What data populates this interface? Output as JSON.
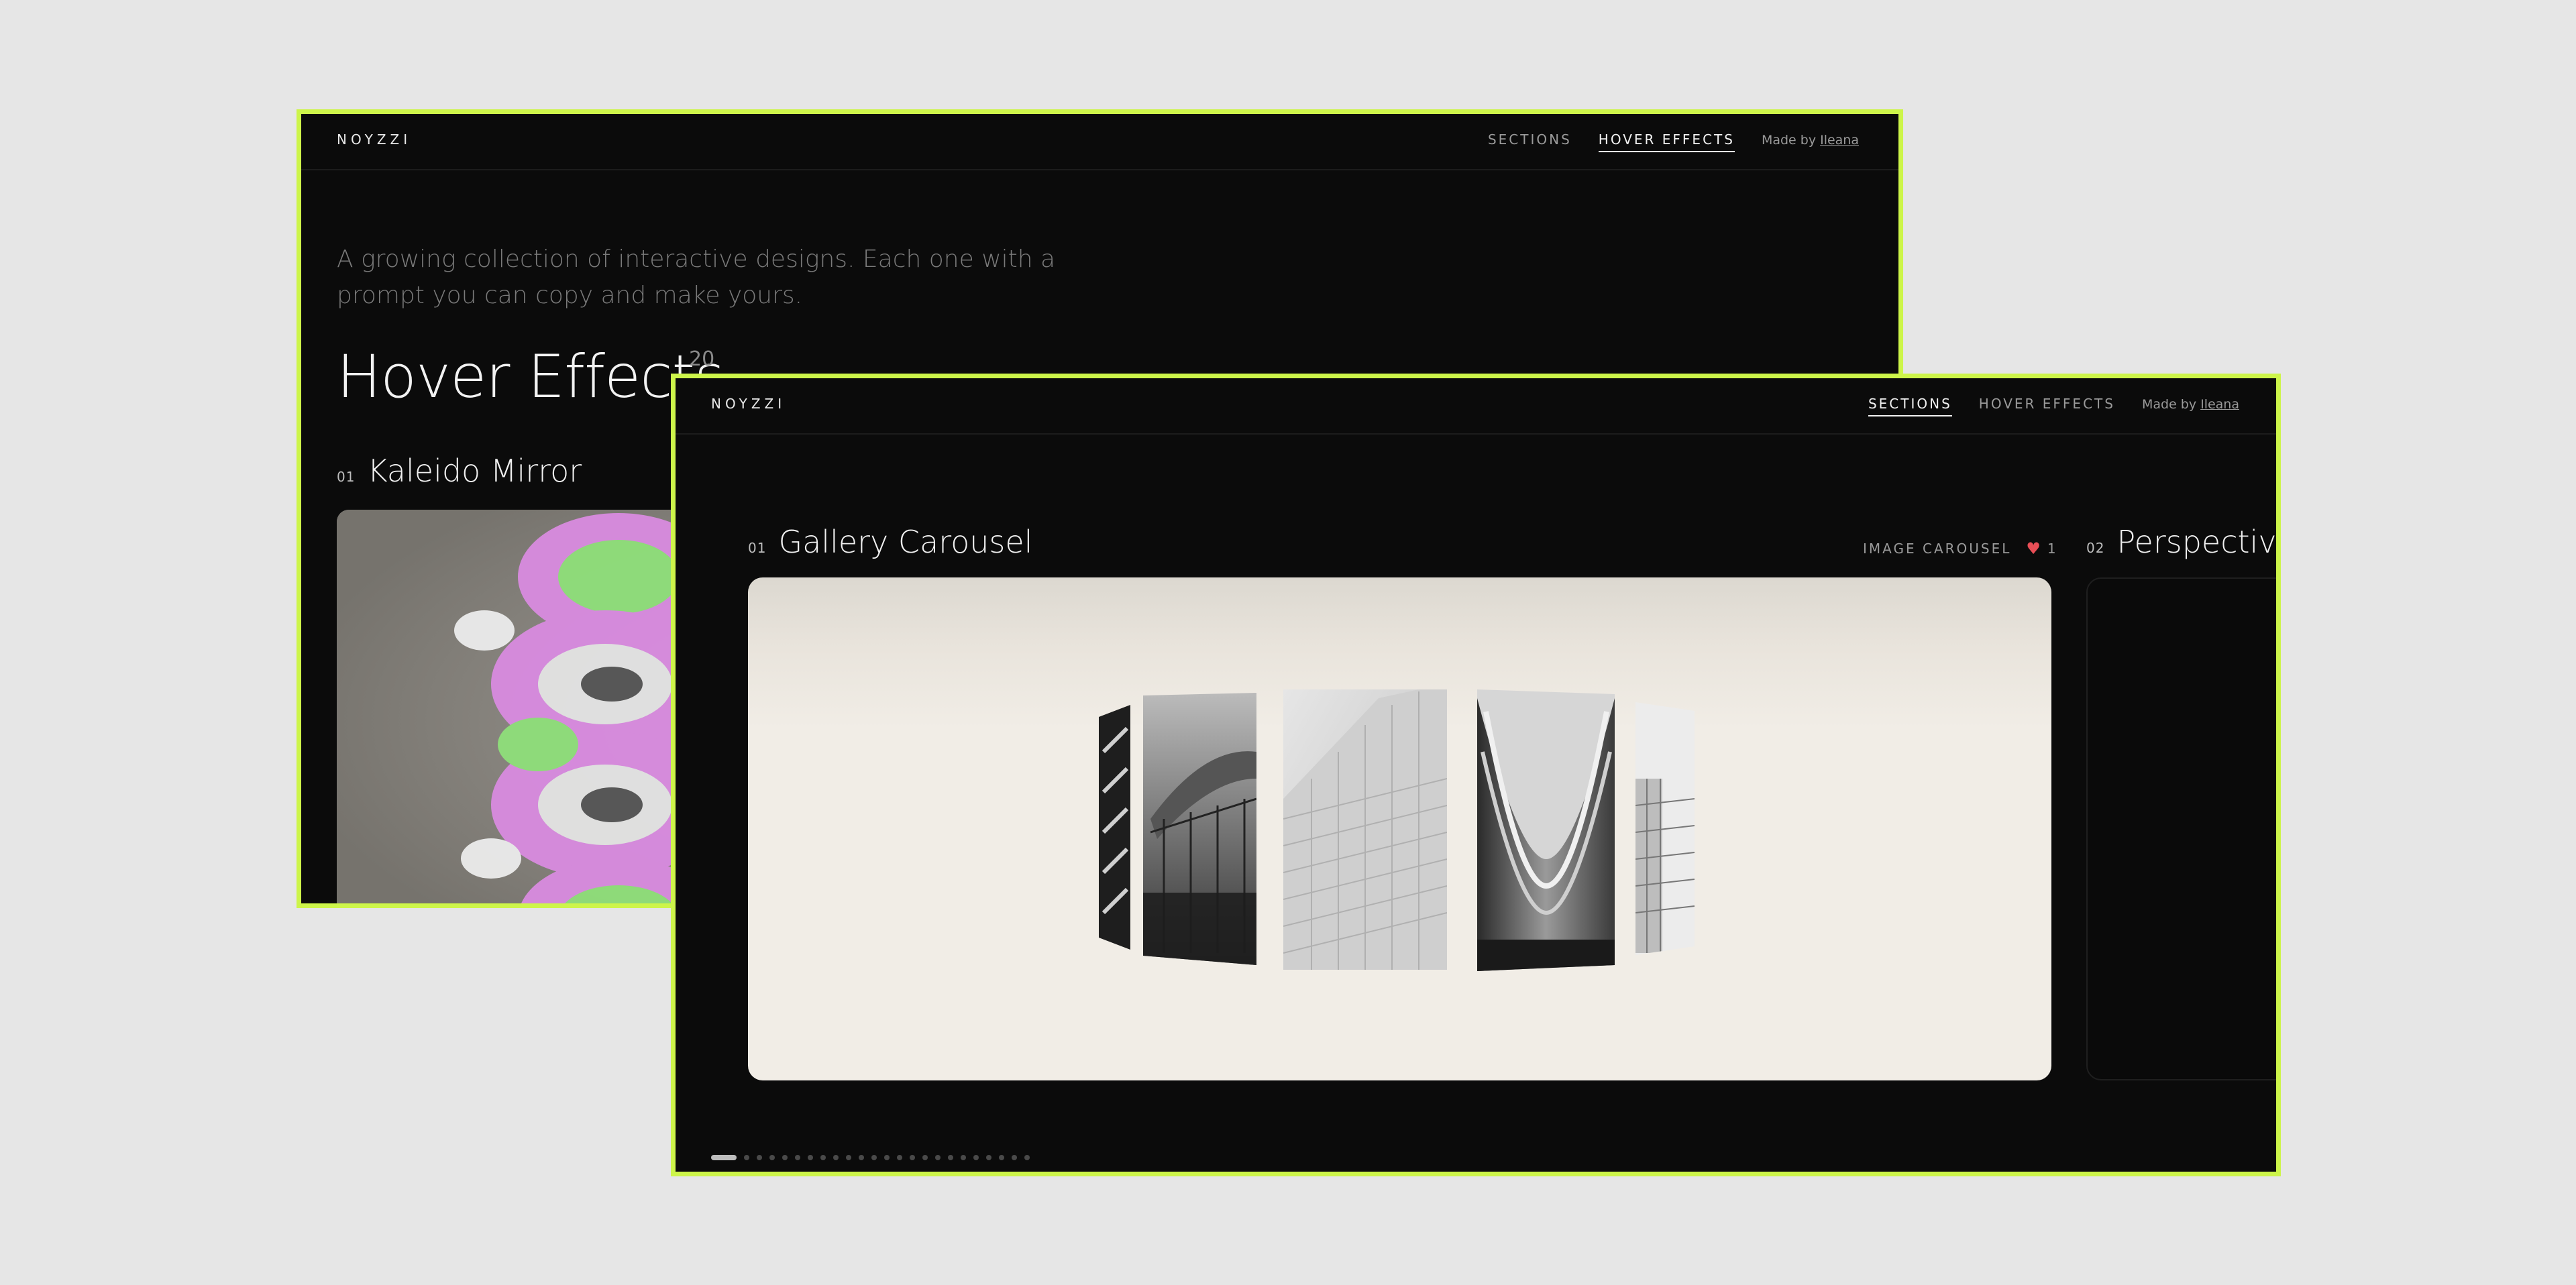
{
  "back_window": {
    "brand": "NOYZZI",
    "nav": {
      "sections": "SECTIONS",
      "hover_effects": "HOVER EFFECTS",
      "made_by": "Made by",
      "author": "Ileana"
    },
    "intro": "A growing collection of interactive designs. Each one with a prompt you can copy and make yours.",
    "title": "Hover Effects",
    "count": "20",
    "item": {
      "number": "01",
      "title": "Kaleido Mirror"
    }
  },
  "front_window": {
    "brand": "NOYZZI",
    "nav": {
      "sections": "SECTIONS",
      "hover_effects": "HOVER EFFECTS",
      "made_by": "Made by",
      "author": "Ileana"
    },
    "items": [
      {
        "number": "01",
        "title": "Gallery Carousel",
        "tag": "IMAGE CAROUSEL",
        "likes": "1"
      },
      {
        "number": "02",
        "title": "Perspective"
      }
    ],
    "pagination": {
      "total": 24,
      "active": 0
    }
  },
  "colors": {
    "frame": "#cdf54a",
    "window_bg": "#0b0b0b",
    "page_bg": "#e6e6e6",
    "heart": "#e84e56",
    "card_bg": "#f1ede6"
  },
  "icons": {
    "like": "heart-icon"
  }
}
